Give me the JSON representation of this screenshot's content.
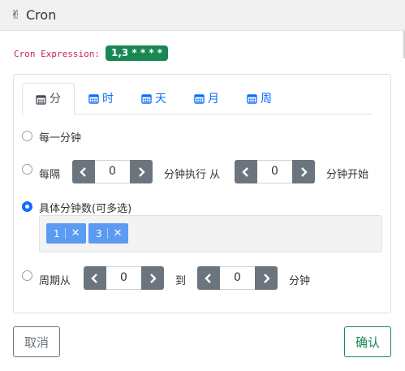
{
  "header": {
    "logo_emoji": "✌",
    "title": "Cron"
  },
  "expression": {
    "label": "Cron Expression:",
    "value": "1,3 * * * *"
  },
  "tabs": [
    {
      "label": "分",
      "icon": "calendar-icon"
    },
    {
      "label": "时",
      "icon": "calendar-icon"
    },
    {
      "label": "天",
      "icon": "calendar-icon"
    },
    {
      "label": "月",
      "icon": "calendar-icon"
    },
    {
      "label": "周",
      "icon": "calendar-icon"
    }
  ],
  "options": {
    "every_minute": {
      "label": "每一分钟",
      "checked": false
    },
    "interval": {
      "label_prefix": "每隔",
      "step_value": "0",
      "label_middle": "分钟执行 从",
      "start_value": "0",
      "label_suffix": "分钟开始",
      "checked": false
    },
    "specific": {
      "label": "具体分钟数(可多选)",
      "checked": true,
      "tags": [
        "1",
        "3"
      ],
      "remove_glyph": "✕"
    },
    "range": {
      "label_prefix": "周期从",
      "from_value": "0",
      "label_middle": "到",
      "to_value": "0",
      "label_suffix": "分钟",
      "checked": false
    }
  },
  "footer": {
    "cancel_label": "取消",
    "confirm_label": "确认"
  },
  "colors": {
    "primary": "#0d6efd",
    "success": "#198754",
    "secondary": "#6c757d",
    "tag": "#5b9bf2",
    "code": "#c7254e"
  }
}
